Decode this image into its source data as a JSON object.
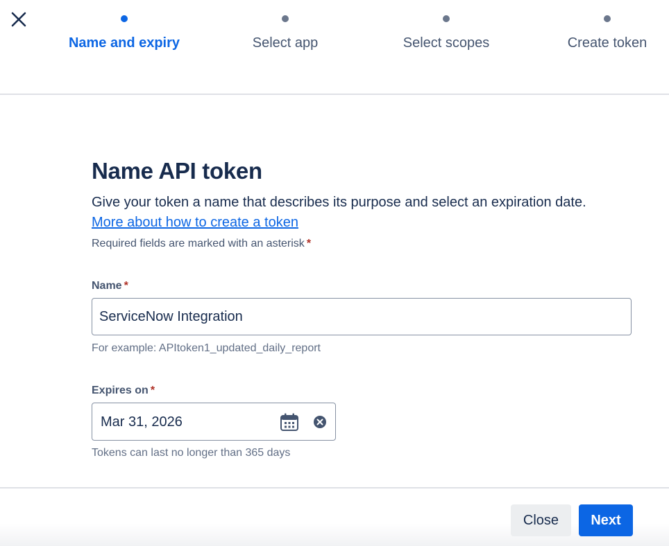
{
  "stepper": {
    "steps": [
      {
        "label": "Name and expiry",
        "active": true
      },
      {
        "label": "Select app",
        "active": false
      },
      {
        "label": "Select scopes",
        "active": false
      },
      {
        "label": "Create token",
        "active": false
      }
    ]
  },
  "icons": {
    "close": "close-icon",
    "calendar": "calendar-icon",
    "clear": "clear-icon"
  },
  "form": {
    "title": "Name API token",
    "description": "Give your token a name that describes its purpose and select an expiration date.",
    "help_link": "More about how to create a token",
    "required_note": "Required fields are marked with an asterisk",
    "asterisk": "*",
    "name_field": {
      "label": "Name",
      "value": "ServiceNow Integration",
      "help": "For example: APItoken1_updated_daily_report"
    },
    "expiry_field": {
      "label": "Expires on",
      "value": "Mar 31, 2026",
      "help": "Tokens can last no longer than 365 days"
    }
  },
  "footer": {
    "close_label": "Close",
    "next_label": "Next"
  },
  "colors": {
    "accent": "#0c66e4",
    "text": "#172b4d",
    "required": "#ae2e24"
  }
}
